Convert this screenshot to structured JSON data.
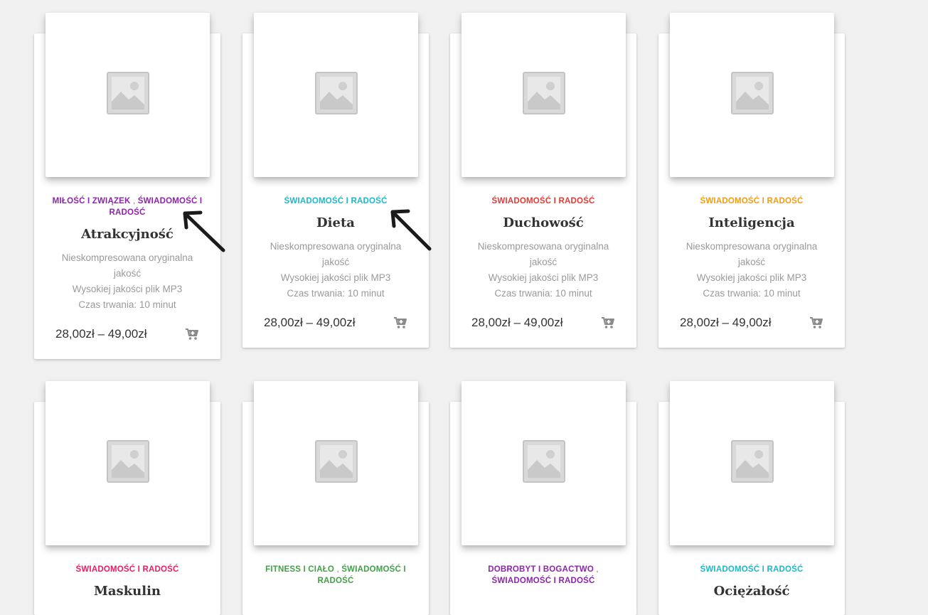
{
  "colors": {
    "purple": "#8e24aa",
    "teal": "#1db8c9",
    "red": "#e53935",
    "orange": "#f39c12",
    "pink": "#e91e63",
    "green": "#43a047",
    "cart_icon": "#8a8a8a"
  },
  "icons": {
    "thumbnail": "image-placeholder-icon",
    "cart": "add-to-cart-icon",
    "annotation": "hand-drawn-arrow"
  },
  "products": [
    {
      "categories": [
        {
          "label": "MIŁOŚĆ I ZWIĄZEK",
          "color": "purple"
        },
        {
          "label": "ŚWIADOMOŚĆ I RADOŚĆ",
          "color": "purple"
        }
      ],
      "title": "Atrakcyjność",
      "desc": [
        "Nieskompresowana oryginalna jakość",
        "Wysokiej jakości plik MP3",
        "Czas trwania: 10 minut"
      ],
      "price": "28,00zł – 49,00zł"
    },
    {
      "categories": [
        {
          "label": "ŚWIADOMOŚĆ I RADOŚĆ",
          "color": "teal"
        }
      ],
      "title": "Dieta",
      "desc": [
        "Nieskompresowana oryginalna jakość",
        "Wysokiej jakości plik MP3",
        "Czas trwania: 10 minut"
      ],
      "price": "28,00zł – 49,00zł"
    },
    {
      "categories": [
        {
          "label": "ŚWIADOMOŚĆ I RADOŚĆ",
          "color": "red"
        }
      ],
      "title": "Duchowość",
      "desc": [
        "Nieskompresowana oryginalna jakość",
        "Wysokiej jakości plik MP3",
        "Czas trwania: 10 minut"
      ],
      "price": "28,00zł – 49,00zł"
    },
    {
      "categories": [
        {
          "label": "ŚWIADOMOŚĆ I RADOŚĆ",
          "color": "orange"
        }
      ],
      "title": "Inteligencja",
      "desc": [
        "Nieskompresowana oryginalna jakość",
        "Wysokiej jakości plik MP3",
        "Czas trwania: 10 minut"
      ],
      "price": "28,00zł – 49,00zł"
    },
    {
      "categories": [
        {
          "label": "ŚWIADOMOŚĆ I RADOŚĆ",
          "color": "pink"
        }
      ],
      "title": "Maskulin",
      "desc": [],
      "price": ""
    },
    {
      "categories": [
        {
          "label": "FITNESS I CIAŁO",
          "color": "green"
        },
        {
          "label": "ŚWIADOMOŚĆ I RADOŚĆ",
          "color": "green"
        }
      ],
      "title": "",
      "desc": [],
      "price": ""
    },
    {
      "categories": [
        {
          "label": "DOBROBYT I BOGACTWO",
          "color": "purple"
        },
        {
          "label": "ŚWIADOMOŚĆ I RADOŚĆ",
          "color": "purple"
        }
      ],
      "title": "",
      "desc": [],
      "price": ""
    },
    {
      "categories": [
        {
          "label": "ŚWIADOMOŚĆ I RADOŚĆ",
          "color": "teal"
        }
      ],
      "title": "Ociężałość",
      "desc": [],
      "price": ""
    }
  ]
}
